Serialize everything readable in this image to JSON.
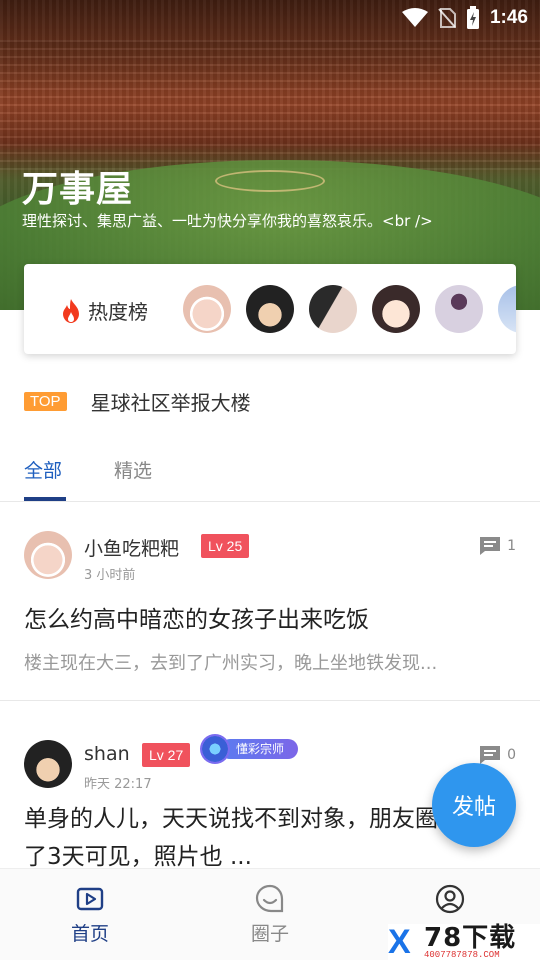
{
  "status_bar": {
    "time": "1:46"
  },
  "hero": {
    "title": "万事屋",
    "description": "理性探讨、集思广益、一吐为快分享你我的喜怒哀乐。<br />"
  },
  "heat_rank": {
    "label": "热度榜",
    "avatars": [
      "baby",
      "goku",
      "girl",
      "cartoon-boy",
      "dancer",
      "blue"
    ]
  },
  "top_notice": {
    "badge": "TOP",
    "text": "星球社区举报大楼"
  },
  "tabs": [
    {
      "label": "全部",
      "active": true
    },
    {
      "label": "精选",
      "active": false
    }
  ],
  "posts": [
    {
      "author": "小鱼吃粑粑",
      "level": "Lv 25",
      "time": "3 小时前",
      "comments": "1",
      "title": "怎么约高中暗恋的女孩子出来吃饭",
      "excerpt": "楼主现在大三，去到了广州实习，晚上坐地铁发现..."
    },
    {
      "author": "shan",
      "level": "Lv 27",
      "badge": "懂彩宗师",
      "time": "昨天 22:17",
      "comments": "0",
      "title": "单身的人儿，天天说找不到对象，朋友圈设置了3天可见，照片也 ..."
    }
  ],
  "fab": {
    "label": "发帖"
  },
  "bottom_nav": [
    {
      "label": "首页",
      "icon": "play-square-icon",
      "active": true
    },
    {
      "label": "圈子",
      "icon": "chat-smile-icon",
      "active": false
    },
    {
      "label": "",
      "icon": "user-circle-icon",
      "active": false
    }
  ],
  "watermark": {
    "brand": "78下载",
    "url": "4007787878.COM"
  },
  "colors": {
    "primary": "#1f3f86",
    "fab": "#2f96ee",
    "level_badge": "#f0525d",
    "top_badge": "#ff9c33"
  }
}
